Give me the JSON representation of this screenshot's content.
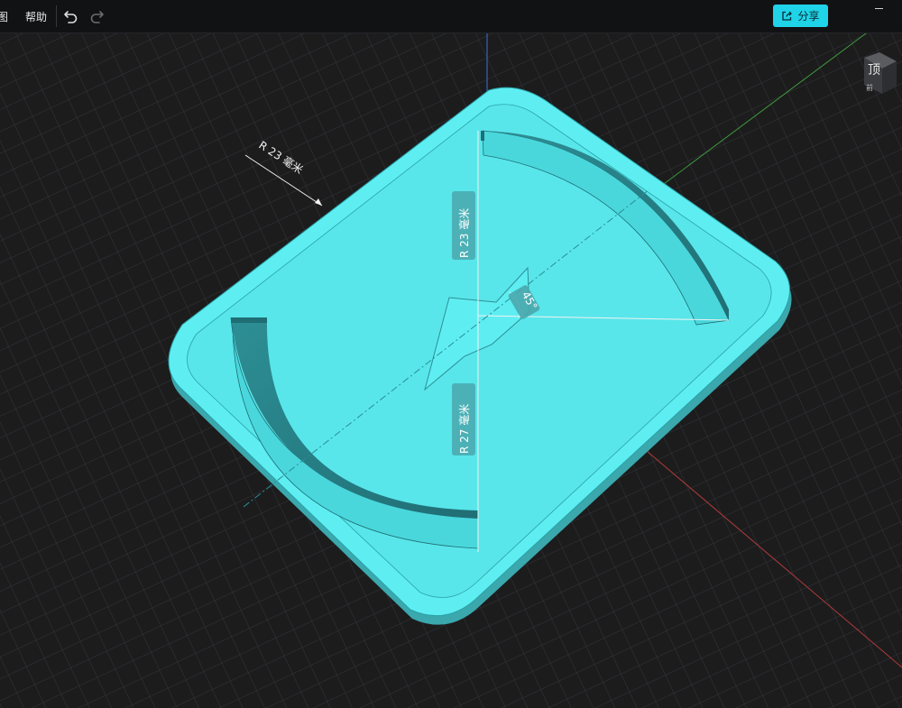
{
  "menu": {
    "view_partial": "图",
    "help": "帮助"
  },
  "toolbar": {
    "undo_icon": "undo-icon",
    "redo_icon": "redo-icon",
    "share_icon": "share-icon",
    "share_label": "分享"
  },
  "view_cube": {
    "face_top": "顶",
    "face_front": "前"
  },
  "annotations": {
    "outer_radius": "R 23 毫米",
    "inner_radius_top": "R 23 毫米",
    "inner_radius_bottom": "R 27 毫米",
    "angle": "45°"
  },
  "colors": {
    "background": "#1c1c1d",
    "toolbar": "#111214",
    "accent": "#1fd3e8",
    "model": "#5eeef2",
    "axis_x": "#b23a3a",
    "axis_y": "#3d9b3d",
    "axis_z": "#3b6fd9"
  }
}
